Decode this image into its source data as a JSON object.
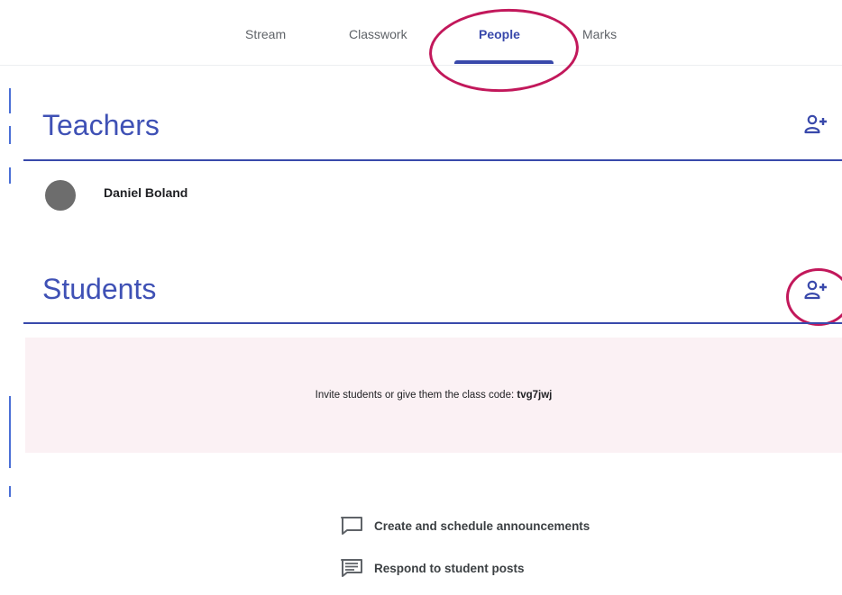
{
  "nav": {
    "tabs": [
      {
        "label": "Stream"
      },
      {
        "label": "Classwork"
      },
      {
        "label": "People"
      },
      {
        "label": "Marks"
      }
    ],
    "active_tab": "People"
  },
  "teachers": {
    "title": "Teachers",
    "add_icon": "add-person-icon",
    "list": [
      {
        "name": "Daniel Boland"
      }
    ]
  },
  "students": {
    "title": "Students",
    "add_icon": "add-person-icon",
    "invite_prefix": "Invite students or give them the class code:",
    "class_code": "tvg7jwj"
  },
  "features": [
    {
      "icon": "chat-bubble-icon",
      "label": "Create and schedule announcements"
    },
    {
      "icon": "comment-lines-icon",
      "label": "Respond to student posts"
    }
  ],
  "colors": {
    "accent": "#3949ab",
    "highlight": "#c2185b",
    "banner": "#fbf1f4"
  }
}
